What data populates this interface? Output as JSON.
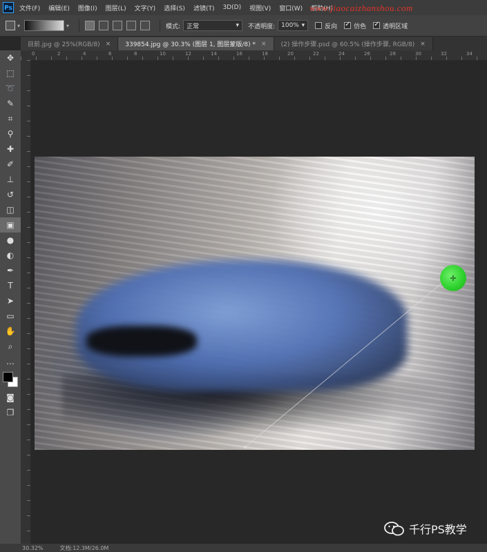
{
  "app": {
    "logo_text": "Ps"
  },
  "menu": [
    "文件(F)",
    "编辑(E)",
    "图像(I)",
    "图层(L)",
    "文字(Y)",
    "选择(S)",
    "滤镜(T)",
    "3D(D)",
    "视图(V)",
    "窗口(W)",
    "帮助(H)"
  ],
  "watermark": "www.jiaocaizhanshou.com",
  "options": {
    "mode_label": "模式:",
    "mode_value": "正常",
    "opacity_label": "不透明度:",
    "opacity_value": "100%",
    "reverse_label": "反向",
    "dither_label": "仿色",
    "transparency_label": "透明区域",
    "reverse_checked": false,
    "dither_checked": true,
    "transparency_checked": true
  },
  "tabs": [
    {
      "label": "目前.jpg @ 25%(RGB/8)",
      "close": "×",
      "active": false
    },
    {
      "label": "339854.jpg @ 30.3% (图层 1, 图层蒙版/8) *",
      "close": "×",
      "active": true
    },
    {
      "label": "(2) 操作步骤.psd @ 60.5% (操作步骤, RGB/8)",
      "close": "×",
      "active": false
    }
  ],
  "ruler_top_labels": [
    "0",
    "2",
    "4",
    "6",
    "8",
    "10",
    "12",
    "14",
    "16",
    "18",
    "20",
    "22",
    "24",
    "26",
    "28",
    "30",
    "32",
    "34"
  ],
  "tools": [
    "move-icon",
    "marquee-icon",
    "lasso-icon",
    "quick-select-icon",
    "crop-icon",
    "eyedropper-icon",
    "healing-icon",
    "brush-icon",
    "stamp-icon",
    "history-brush-icon",
    "eraser-icon",
    "gradient-icon",
    "blur-icon",
    "dodge-icon",
    "pen-icon",
    "type-icon",
    "path-select-icon",
    "rectangle-icon",
    "hand-icon",
    "zoom-icon",
    "more-icon"
  ],
  "colors": {
    "foreground": "#000000",
    "background": "#ffffff",
    "cursor": "#2bcf2a"
  },
  "status": {
    "zoom": "30.32%",
    "doc": "文档:12.3M/26.0M"
  },
  "branding": {
    "text": "千行PS教学"
  }
}
